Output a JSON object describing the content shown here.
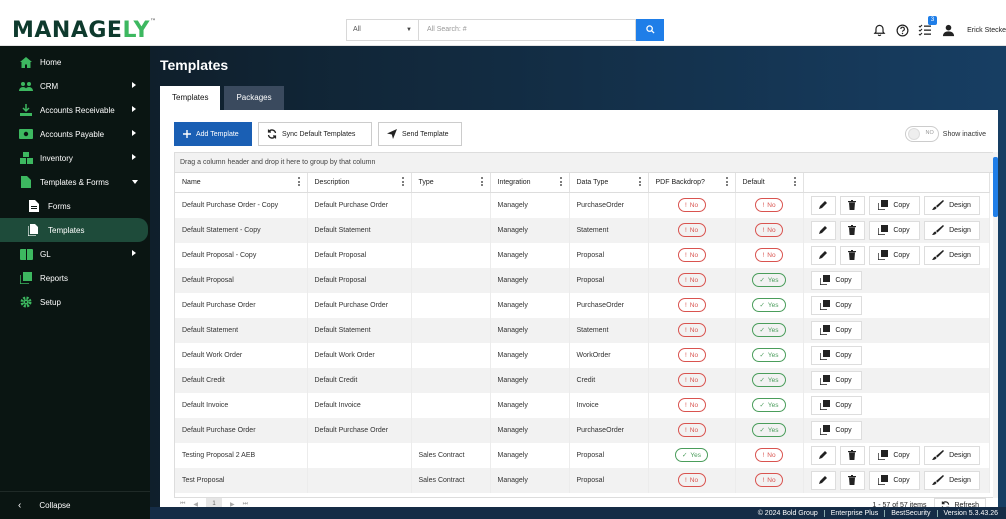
{
  "app": {
    "logo_main": "MANAGE",
    "logo_accent": "LY",
    "logo_tm": "™"
  },
  "topbar": {
    "search_scope": "All",
    "search_placeholder": "All Search: #",
    "notification_count": "3",
    "user_name": "Erick Stecke"
  },
  "sidebar": {
    "items": [
      {
        "label": "Home",
        "icon": "home-icon"
      },
      {
        "label": "CRM",
        "icon": "people-icon"
      },
      {
        "label": "Accounts Receivable",
        "icon": "receivable-icon"
      },
      {
        "label": "Accounts Payable",
        "icon": "payable-icon"
      },
      {
        "label": "Inventory",
        "icon": "inventory-icon"
      },
      {
        "label": "Templates & Forms",
        "icon": "document-icon"
      },
      {
        "label": "Forms",
        "icon": "form-icon"
      },
      {
        "label": "Templates",
        "icon": "templates-icon"
      },
      {
        "label": "GL",
        "icon": "ledger-icon"
      },
      {
        "label": "Reports",
        "icon": "reports-icon"
      },
      {
        "label": "Setup",
        "icon": "gear-icon"
      }
    ],
    "collapse_label": "Collapse"
  },
  "main": {
    "title": "Templates",
    "tabs": [
      {
        "label": "Templates"
      },
      {
        "label": "Packages"
      }
    ],
    "toolbar": {
      "add_label": "Add Template",
      "sync_label": "Sync Default Templates",
      "send_label": "Send Template",
      "toggle_state": "NO",
      "show_inactive_label": "Show inactive"
    },
    "group_hint": "Drag a column header and drop it here to group by that column",
    "columns": [
      "Name",
      "Description",
      "Type",
      "Integration",
      "Data Type",
      "PDF Backdrop?",
      "Default"
    ],
    "rows": [
      {
        "name": "Default Purchase Order - Copy",
        "description": "Default Purchase Order",
        "type": "",
        "integration": "Managely",
        "data_type": "PurchaseOrder",
        "pdf": "No",
        "def": "No",
        "actions": "full"
      },
      {
        "name": "Default Statement - Copy",
        "description": "Default Statement",
        "type": "",
        "integration": "Managely",
        "data_type": "Statement",
        "pdf": "No",
        "def": "No",
        "actions": "full"
      },
      {
        "name": "Default Proposal - Copy",
        "description": "Default Proposal",
        "type": "",
        "integration": "Managely",
        "data_type": "Proposal",
        "pdf": "No",
        "def": "No",
        "actions": "full"
      },
      {
        "name": "Default Proposal",
        "description": "Default Proposal",
        "type": "",
        "integration": "Managely",
        "data_type": "Proposal",
        "pdf": "No",
        "def": "Yes",
        "actions": "copy"
      },
      {
        "name": "Default Purchase Order",
        "description": "Default Purchase Order",
        "type": "",
        "integration": "Managely",
        "data_type": "PurchaseOrder",
        "pdf": "No",
        "def": "Yes",
        "actions": "copy"
      },
      {
        "name": "Default Statement",
        "description": "Default Statement",
        "type": "",
        "integration": "Managely",
        "data_type": "Statement",
        "pdf": "No",
        "def": "Yes",
        "actions": "copy"
      },
      {
        "name": "Default Work Order",
        "description": "Default Work Order",
        "type": "",
        "integration": "Managely",
        "data_type": "WorkOrder",
        "pdf": "No",
        "def": "Yes",
        "actions": "copy"
      },
      {
        "name": "Default Credit",
        "description": "Default Credit",
        "type": "",
        "integration": "Managely",
        "data_type": "Credit",
        "pdf": "No",
        "def": "Yes",
        "actions": "copy"
      },
      {
        "name": "Default Invoice",
        "description": "Default Invoice",
        "type": "",
        "integration": "Managely",
        "data_type": "Invoice",
        "pdf": "No",
        "def": "Yes",
        "actions": "copy"
      },
      {
        "name": "Default Purchase Order",
        "description": "Default Purchase Order",
        "type": "",
        "integration": "Managely",
        "data_type": "PurchaseOrder",
        "pdf": "No",
        "def": "Yes",
        "actions": "copy"
      },
      {
        "name": "Testing Proposal 2 AEB",
        "description": "",
        "type": "Sales Contract",
        "integration": "Managely",
        "data_type": "Proposal",
        "pdf": "Yes",
        "def": "No",
        "actions": "full"
      },
      {
        "name": "Test Proposal",
        "description": "",
        "type": "Sales Contract",
        "integration": "Managely",
        "data_type": "Proposal",
        "pdf": "No",
        "def": "No",
        "actions": "full"
      }
    ],
    "copy_label": "Copy",
    "design_label": "Design",
    "pager": {
      "first": "⏮",
      "prev": "◀",
      "current_page": "1",
      "next": "▶",
      "last": "⏭",
      "summary": "1 - 57 of 57 items",
      "refresh_label": "Refresh"
    }
  },
  "footer": {
    "items": [
      "© 2024 Bold Group",
      "Enterprise Plus",
      "BestSecurity",
      "Version 5.3.43.26"
    ]
  },
  "colors": {
    "primary": "#1a5fb4",
    "accent_green": "#3db860",
    "no_red": "#d9534f",
    "yes_green": "#4a9d5b"
  }
}
